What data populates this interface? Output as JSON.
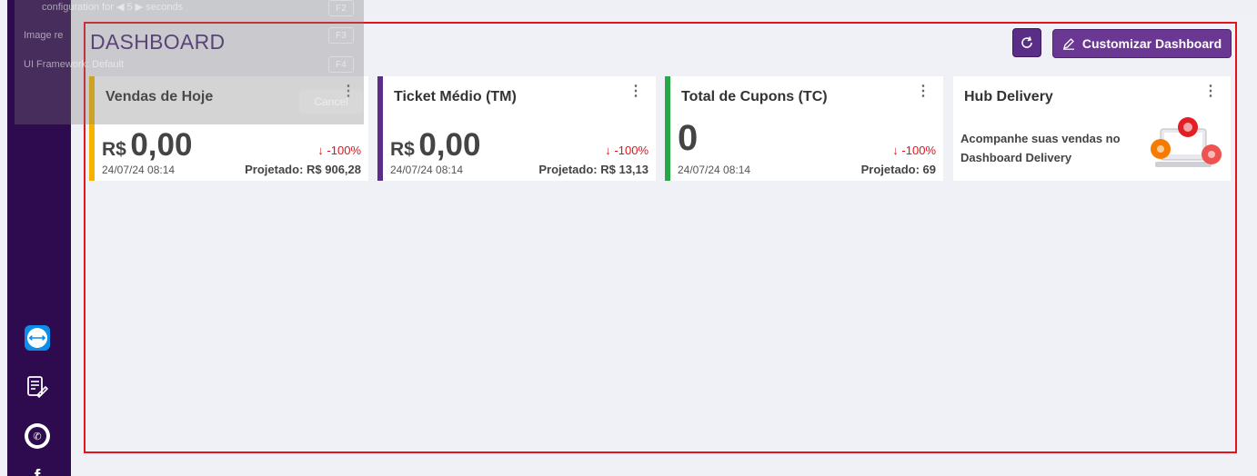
{
  "overlay": {
    "row1_pre": "configuration for",
    "row1_num": "5",
    "row1_post": "seconds",
    "row1_key": "F2",
    "row2": "Image re",
    "row2_key": "F3",
    "row3": "UI Framework: Default",
    "row3_key": "F4",
    "cancel": "Cancel"
  },
  "header": {
    "title": "DASHBOARD",
    "customize_label": "Customizar Dashboard"
  },
  "cards": [
    {
      "title": "Vendas de Hoje",
      "currency": "R$",
      "value": "0,00",
      "delta": "-100%",
      "date": "24/07/24 08:14",
      "projected": "Projetado: R$ 906,28"
    },
    {
      "title": "Ticket Médio (TM)",
      "currency": "R$",
      "value": "0,00",
      "delta": "-100%",
      "date": "24/07/24 08:14",
      "projected": "Projetado: R$ 13,13"
    },
    {
      "title": "Total de Cupons (TC)",
      "value": "0",
      "delta": "-100%",
      "date": "24/07/24 08:14",
      "projected": "Projetado: 69"
    },
    {
      "title": "Hub Delivery",
      "text": "Acompanhe suas vendas no Dashboard Delivery"
    }
  ],
  "colors": {
    "sidebar": "#2e0a4f",
    "accent": "#6a3793",
    "yellow": "#f6b400",
    "purple": "#5a2d87",
    "green": "#28a745",
    "negative": "#e0131b"
  },
  "icons": [
    "teamviewer-icon",
    "document-sign-icon",
    "whatsapp-icon",
    "facebook-icon",
    "refresh-icon",
    "edit-icon",
    "kebab-menu-icon",
    "arrow-down-icon"
  ]
}
